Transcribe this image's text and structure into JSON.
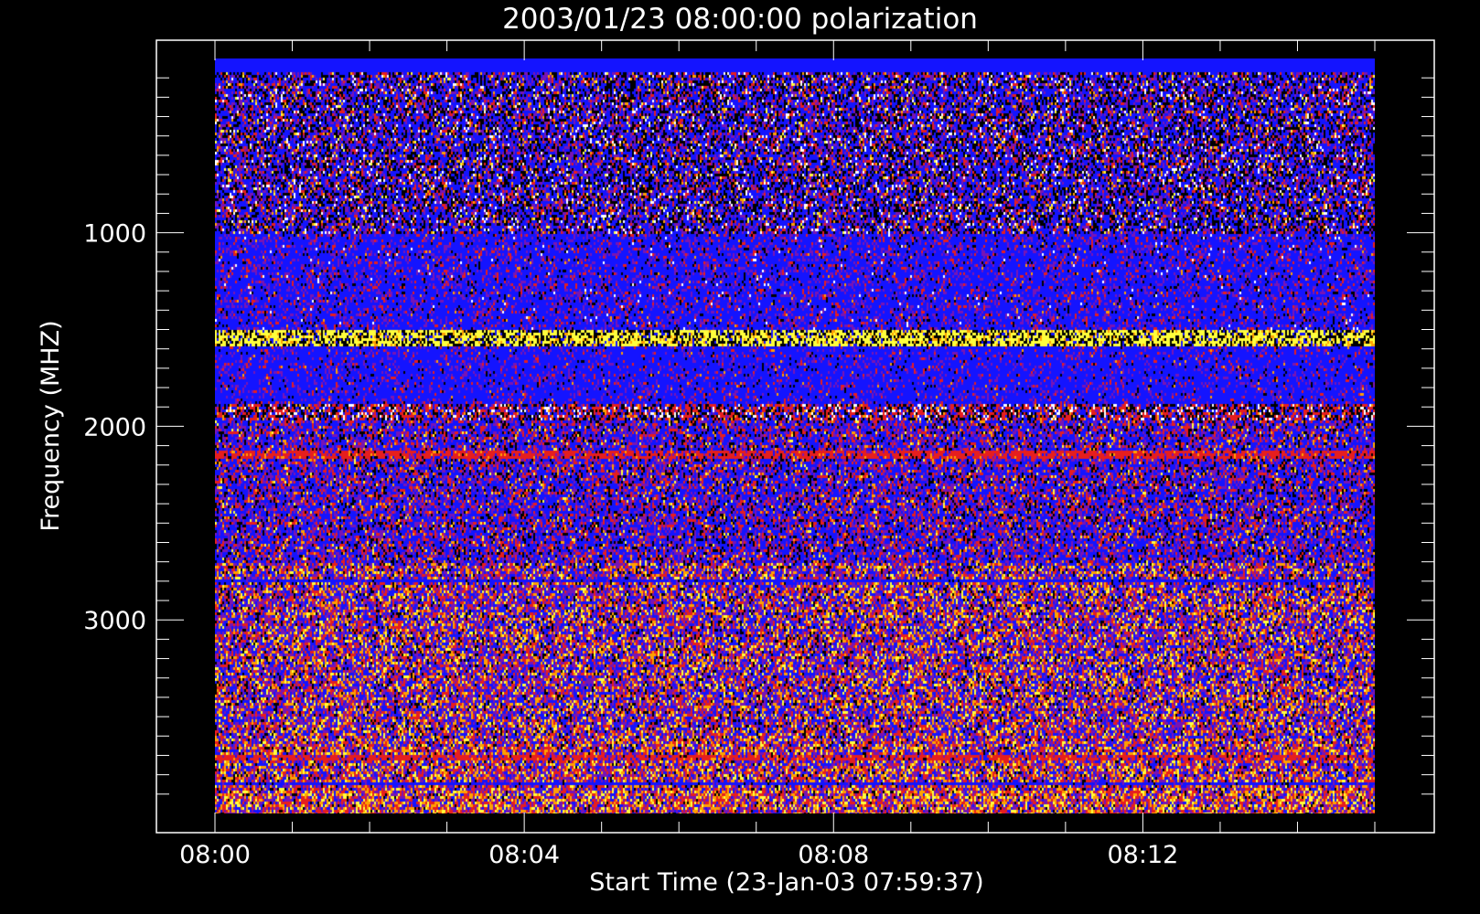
{
  "chart_data": {
    "type": "heatmap",
    "title": "2003/01/23 08:00:00 polarization",
    "xlabel": "Start Time (23-Jan-03 07:59:37)",
    "ylabel": "Frequency (MHZ)",
    "x_tick_labels": [
      "08:00",
      "08:04",
      "08:08",
      "08:12"
    ],
    "x_ticks_minutes": [
      0,
      4,
      8,
      12
    ],
    "x_data_range_minutes": [
      0,
      15
    ],
    "y_tick_labels": [
      "1000",
      "2000",
      "3000"
    ],
    "y_ticks": [
      1000,
      2000,
      3000
    ],
    "y_data_range": [
      100,
      4000
    ],
    "y_axis_inverted": true,
    "colormap": [
      "#000000",
      "#1414ff",
      "#7814b4",
      "#e61e1e",
      "#ffa000",
      "#ffff3c",
      "#ffffff"
    ],
    "notable_bands_mhz": [
      {
        "freq": 1550,
        "description": "yellow/black alternating band"
      },
      {
        "freq": 1900,
        "description": "red/white band"
      },
      {
        "freq": 2140,
        "description": "red band"
      },
      {
        "freq": 3700,
        "description": "red band"
      },
      {
        "freq": 3840,
        "description": "blue band"
      }
    ]
  }
}
